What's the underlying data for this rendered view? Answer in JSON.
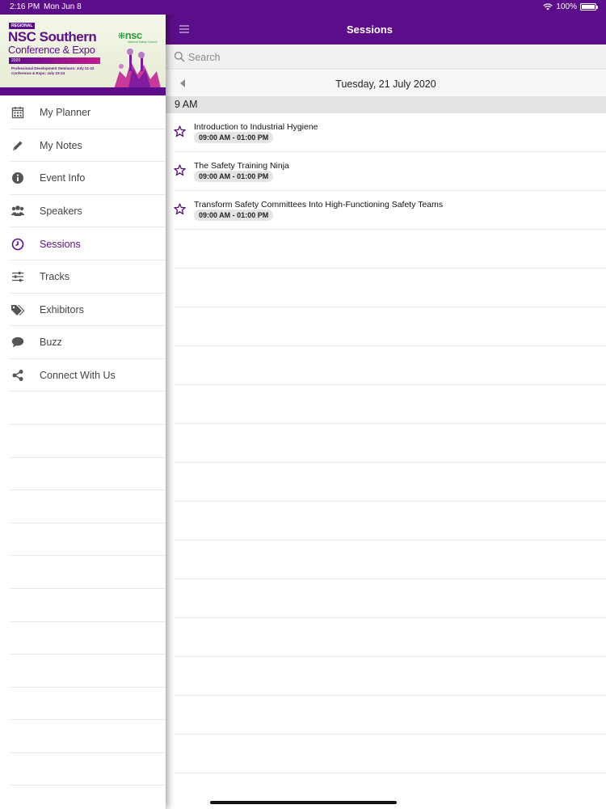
{
  "status_bar": {
    "time": "2:16 PM",
    "date": "Mon Jun 8",
    "battery": "100%"
  },
  "banner": {
    "tag": "REGIONAL",
    "title_line1_a": "NSC",
    "title_line1_b": "Southern",
    "title_line2": "Conference & Expo",
    "year": "2020",
    "subtitle1": "Professional Development Seminars: July 21-22",
    "subtitle2": "Conference & Expo: July 23-24",
    "logo": "nsc",
    "logo_sub": "National Safety Council"
  },
  "sidebar": {
    "items": [
      {
        "label": "My Planner",
        "icon": "calendar-icon",
        "active": false
      },
      {
        "label": "My Notes",
        "icon": "pencil-icon",
        "active": false
      },
      {
        "label": "Event Info",
        "icon": "info-icon",
        "active": false
      },
      {
        "label": "Speakers",
        "icon": "people-icon",
        "active": false
      },
      {
        "label": "Sessions",
        "icon": "clock-icon",
        "active": true
      },
      {
        "label": "Tracks",
        "icon": "sliders-icon",
        "active": false
      },
      {
        "label": "Exhibitors",
        "icon": "tags-icon",
        "active": false
      },
      {
        "label": "Buzz",
        "icon": "chat-bubble-icon",
        "active": false
      },
      {
        "label": "Connect With Us",
        "icon": "share-icon",
        "active": false
      }
    ]
  },
  "header": {
    "title": "Sessions"
  },
  "search": {
    "placeholder": "Search",
    "value": ""
  },
  "date_nav": {
    "date": "Tuesday, 21 July 2020"
  },
  "hour_group": {
    "label": "9 AM"
  },
  "sessions": [
    {
      "title": "Introduction to Industrial Hygiene",
      "time": "09:00 AM - 01:00 PM"
    },
    {
      "title": "The Safety Training Ninja",
      "time": "09:00 AM - 01:00 PM"
    },
    {
      "title": "Transform Safety Committees Into High-Functioning Safety Teams",
      "time": "09:00 AM - 01:00 PM"
    }
  ],
  "colors": {
    "brand": "#5c0d8a",
    "accent_green": "#2a9d3c",
    "separator": "#e6e6e6"
  }
}
